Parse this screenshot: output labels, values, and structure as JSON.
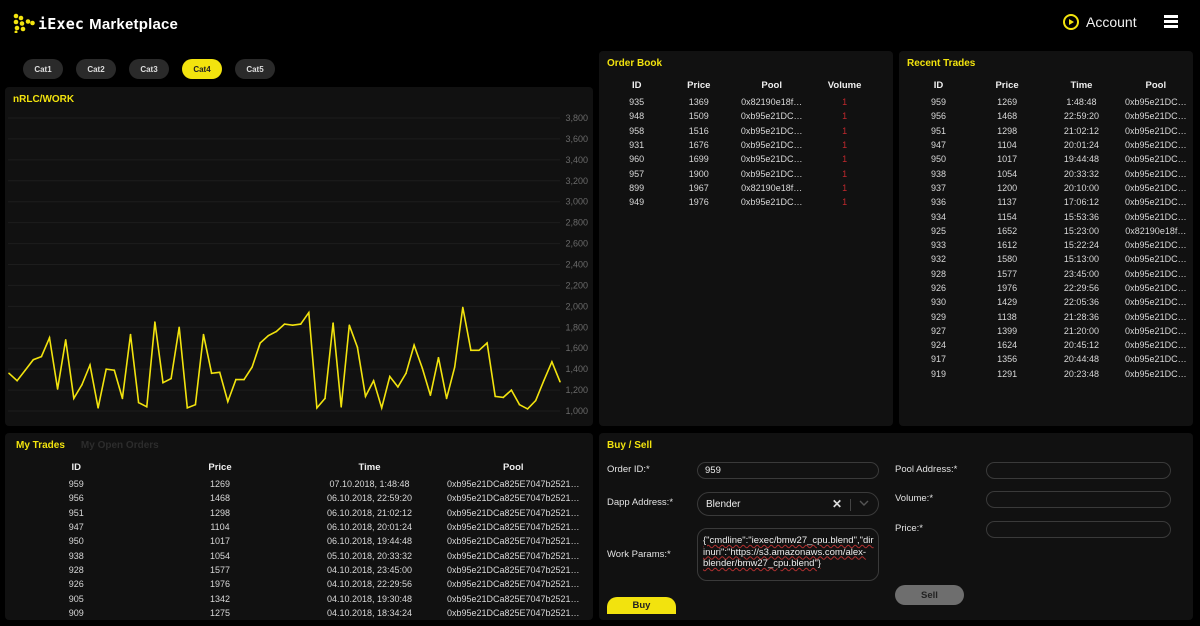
{
  "header": {
    "brand_prefix": "iExec",
    "brand_name": "Marketplace",
    "account_label": "Account"
  },
  "categories": [
    {
      "label": "Cat1",
      "active": false
    },
    {
      "label": "Cat2",
      "active": false
    },
    {
      "label": "Cat3",
      "active": false
    },
    {
      "label": "Cat4",
      "active": true
    },
    {
      "label": "Cat5",
      "active": false
    }
  ],
  "colors": {
    "accent": "#f2e30e",
    "panel_bg": "#111111",
    "page_bg": "#000000",
    "volume_red": "#c0282d"
  },
  "chart_data": {
    "type": "line",
    "title": "nRLC/WORK",
    "xlabel": "",
    "ylabel": "",
    "ylim": [
      1000,
      3800
    ],
    "yticks": [
      1000,
      1200,
      1400,
      1600,
      1800,
      2000,
      2200,
      2400,
      2600,
      2800,
      3000,
      3200,
      3400,
      3600,
      3800
    ],
    "ytick_labels": [
      "1,000",
      "1,200",
      "1,400",
      "1,600",
      "1,800",
      "2,000",
      "2,200",
      "2,400",
      "2,600",
      "2,800",
      "3,000",
      "3,200",
      "3,400",
      "3,600",
      "3,800"
    ],
    "y_axis_side": "right",
    "grid": true,
    "series": [
      {
        "name": "nRLC/WORK",
        "color": "#f2e30e",
        "values": [
          1360,
          1290,
          1390,
          1490,
          1520,
          1700,
          1210,
          1680,
          1120,
          1250,
          1440,
          1030,
          1400,
          1390,
          1120,
          1730,
          1080,
          1040,
          1850,
          1270,
          1310,
          1800,
          1030,
          1060,
          1730,
          1360,
          1370,
          1090,
          1300,
          1300,
          1420,
          1650,
          1720,
          1760,
          1830,
          1820,
          1830,
          1940,
          1030,
          1120,
          1840,
          1040,
          1820,
          1610,
          1140,
          1290,
          1030,
          1330,
          1230,
          1360,
          1630,
          1410,
          1150,
          1510,
          1120,
          1420,
          1990,
          1580,
          1580,
          1650,
          1140,
          1130,
          1200,
          1060,
          1020,
          1100,
          1290,
          1470,
          1280
        ]
      }
    ]
  },
  "order_book": {
    "title": "Order Book",
    "columns": [
      "ID",
      "Price",
      "Pool",
      "Volume"
    ],
    "rows": [
      [
        "935",
        "1369",
        "0x82190e18f…",
        "1"
      ],
      [
        "948",
        "1509",
        "0xb95e21DC…",
        "1"
      ],
      [
        "958",
        "1516",
        "0xb95e21DC…",
        "1"
      ],
      [
        "931",
        "1676",
        "0xb95e21DC…",
        "1"
      ],
      [
        "960",
        "1699",
        "0xb95e21DC…",
        "1"
      ],
      [
        "957",
        "1900",
        "0xb95e21DC…",
        "1"
      ],
      [
        "899",
        "1967",
        "0x82190e18f…",
        "1"
      ],
      [
        "949",
        "1976",
        "0xb95e21DC…",
        "1"
      ]
    ]
  },
  "recent_trades": {
    "title": "Recent Trades",
    "columns": [
      "ID",
      "Price",
      "Time",
      "Pool"
    ],
    "rows": [
      [
        "959",
        "1269",
        "1:48:48",
        "0xb95e21DC…"
      ],
      [
        "956",
        "1468",
        "22:59:20",
        "0xb95e21DC…"
      ],
      [
        "951",
        "1298",
        "21:02:12",
        "0xb95e21DC…"
      ],
      [
        "947",
        "1104",
        "20:01:24",
        "0xb95e21DC…"
      ],
      [
        "950",
        "1017",
        "19:44:48",
        "0xb95e21DC…"
      ],
      [
        "938",
        "1054",
        "20:33:32",
        "0xb95e21DC…"
      ],
      [
        "937",
        "1200",
        "20:10:00",
        "0xb95e21DC…"
      ],
      [
        "936",
        "1137",
        "17:06:12",
        "0xb95e21DC…"
      ],
      [
        "934",
        "1154",
        "15:53:36",
        "0xb95e21DC…"
      ],
      [
        "925",
        "1652",
        "15:23:00",
        "0x82190e18f…"
      ],
      [
        "933",
        "1612",
        "15:22:24",
        "0xb95e21DC…"
      ],
      [
        "932",
        "1580",
        "15:13:00",
        "0xb95e21DC…"
      ],
      [
        "928",
        "1577",
        "23:45:00",
        "0xb95e21DC…"
      ],
      [
        "926",
        "1976",
        "22:29:56",
        "0xb95e21DC…"
      ],
      [
        "930",
        "1429",
        "22:05:36",
        "0xb95e21DC…"
      ],
      [
        "929",
        "1138",
        "21:28:36",
        "0xb95e21DC…"
      ],
      [
        "927",
        "1399",
        "21:20:00",
        "0xb95e21DC…"
      ],
      [
        "924",
        "1624",
        "20:45:12",
        "0xb95e21DC…"
      ],
      [
        "917",
        "1356",
        "20:44:48",
        "0xb95e21DC…"
      ],
      [
        "919",
        "1291",
        "20:23:48",
        "0xb95e21DC…"
      ]
    ]
  },
  "my_trades": {
    "tabs": [
      {
        "label": "My Trades",
        "active": true
      },
      {
        "label": "My Open Orders",
        "active": false
      }
    ],
    "columns": [
      "ID",
      "Price",
      "Time",
      "Pool"
    ],
    "rows": [
      [
        "959",
        "1269",
        "07.10.2018, 1:48:48",
        "0xb95e21DCa825E7047b2521…"
      ],
      [
        "956",
        "1468",
        "06.10.2018, 22:59:20",
        "0xb95e21DCa825E7047b2521…"
      ],
      [
        "951",
        "1298",
        "06.10.2018, 21:02:12",
        "0xb95e21DCa825E7047b2521…"
      ],
      [
        "947",
        "1104",
        "06.10.2018, 20:01:24",
        "0xb95e21DCa825E7047b2521…"
      ],
      [
        "950",
        "1017",
        "06.10.2018, 19:44:48",
        "0xb95e21DCa825E7047b2521…"
      ],
      [
        "938",
        "1054",
        "05.10.2018, 20:33:32",
        "0xb95e21DCa825E7047b2521…"
      ],
      [
        "928",
        "1577",
        "04.10.2018, 23:45:00",
        "0xb95e21DCa825E7047b2521…"
      ],
      [
        "926",
        "1976",
        "04.10.2018, 22:29:56",
        "0xb95e21DCa825E7047b2521…"
      ],
      [
        "905",
        "1342",
        "04.10.2018, 19:30:48",
        "0xb95e21DCa825E7047b2521…"
      ],
      [
        "909",
        "1275",
        "04.10.2018, 18:34:24",
        "0xb95e21DCa825E7047b2521…"
      ]
    ]
  },
  "buy_sell": {
    "title": "Buy / Sell",
    "order_id_label": "Order ID:*",
    "order_id_value": "959",
    "dapp_label": "Dapp Address:*",
    "dapp_value": "Blender",
    "work_params_label": "Work Params:*",
    "work_params_value": "{\"cmdline\":\"iexec/bmw27_cpu.blend\",\"dirinuri\":\"https://s3.amazonaws.com/alex-blender/bmw27_cpu.blend\"}",
    "pool_address_label": "Pool Address:*",
    "pool_address_value": "",
    "volume_label": "Volume:*",
    "volume_value": "",
    "price_label": "Price:*",
    "price_value": "",
    "buy_label": "Buy",
    "sell_label": "Sell"
  }
}
